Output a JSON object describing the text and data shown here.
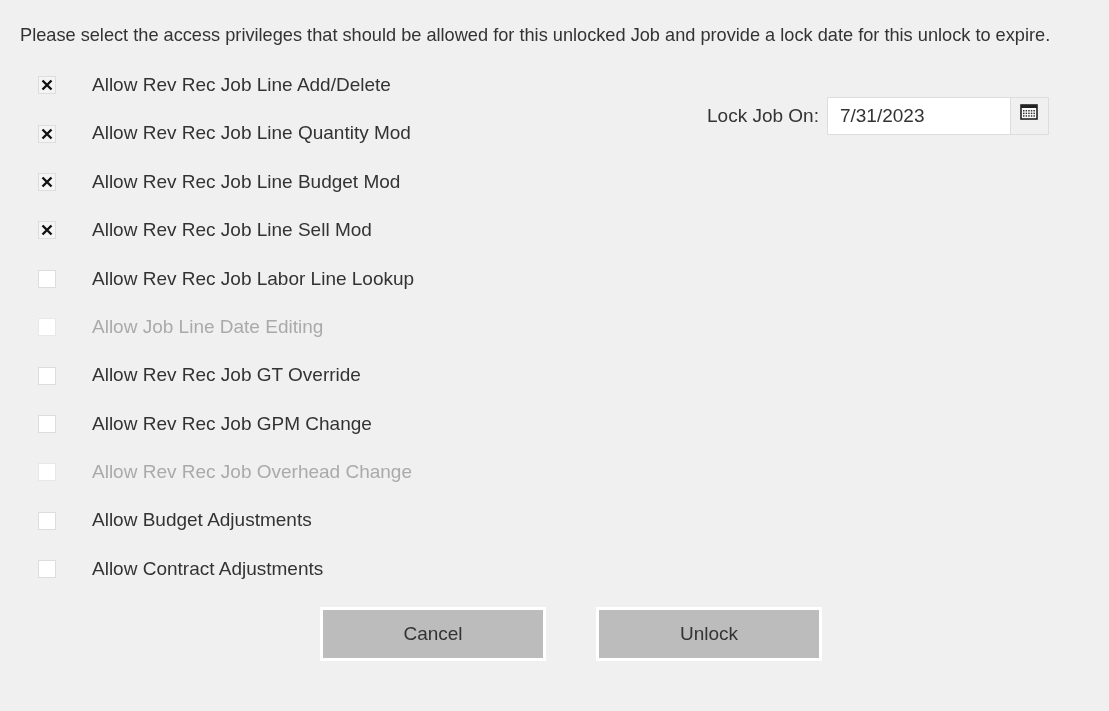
{
  "intro": "Please select the access privileges that should be allowed for this unlocked Job and provide a lock date for this unlock to expire.",
  "privileges": [
    {
      "label": "Allow Rev Rec Job Line Add/Delete",
      "checked": true,
      "disabled": false
    },
    {
      "label": "Allow Rev Rec Job Line Quantity Mod",
      "checked": true,
      "disabled": false
    },
    {
      "label": "Allow Rev Rec Job Line Budget Mod",
      "checked": true,
      "disabled": false
    },
    {
      "label": "Allow Rev Rec Job Line Sell Mod",
      "checked": true,
      "disabled": false
    },
    {
      "label": "Allow Rev Rec Job Labor Line Lookup",
      "checked": false,
      "disabled": false
    },
    {
      "label": "Allow Job Line Date Editing",
      "checked": false,
      "disabled": true
    },
    {
      "label": "Allow Rev Rec Job GT Override",
      "checked": false,
      "disabled": false
    },
    {
      "label": "Allow Rev Rec Job GPM Change",
      "checked": false,
      "disabled": false
    },
    {
      "label": "Allow Rev Rec Job Overhead Change",
      "checked": false,
      "disabled": true
    },
    {
      "label": "Allow Budget Adjustments",
      "checked": false,
      "disabled": false
    },
    {
      "label": "Allow Contract Adjustments",
      "checked": false,
      "disabled": false
    }
  ],
  "lock_date": {
    "label": "Lock Job On:",
    "value": "7/31/2023"
  },
  "buttons": [
    "Cancel",
    "Unlock"
  ]
}
